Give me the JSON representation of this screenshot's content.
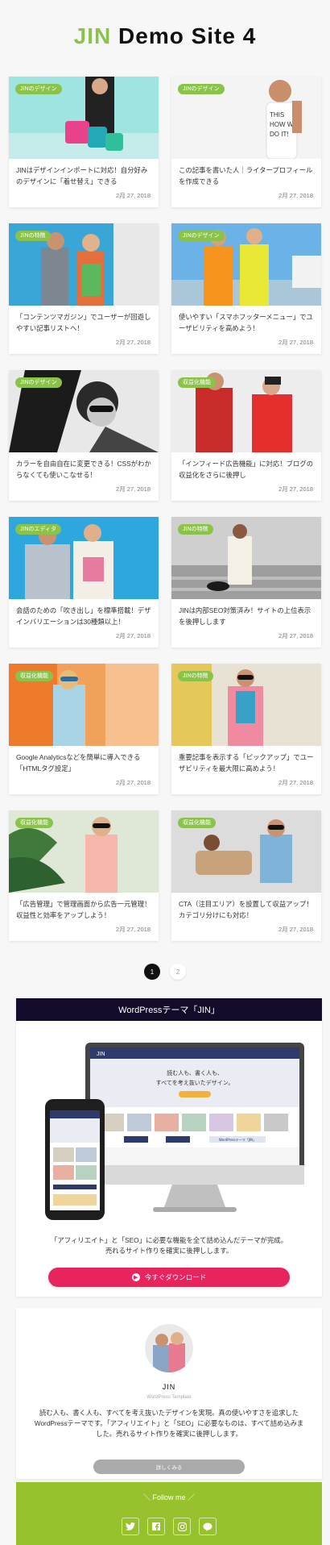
{
  "header": {
    "title_accent": "JIN",
    "title_rest": " Demo Site 4"
  },
  "posts": [
    {
      "category": "JINのデザイン",
      "title": "JINはデザインインポートに対応！自分好みのデザインに「着せ替え」できる",
      "date": "2月 27, 2018"
    },
    {
      "category": "JINのデザイン",
      "title": "この記事を書いた人｜ライタープロフィールを作成できる",
      "date": "2月 27, 2018"
    },
    {
      "category": "JINの特徴",
      "title": "「コンテンツマガジン」でユーザーが回遊しやすい記事リストへ！",
      "date": "2月 27, 2018"
    },
    {
      "category": "JINのデザイン",
      "title": "使いやすい「スマホフッターメニュー」でユーザビリティを高めよう！",
      "date": "2月 27, 2018"
    },
    {
      "category": "JINのデザイン",
      "title": "カラーを自由自在に変更できる！CSSがわからなくても使いこなせる！",
      "date": "2月 27, 2018"
    },
    {
      "category": "収益化機能",
      "title": "「インフィード広告機能」に対応！ブログの収益化をさらに後押し",
      "date": "2月 27, 2018"
    },
    {
      "category": "JINのエディタ",
      "title": "会話のための「吹き出し」を標準搭載！デザインバリエーションは30種類以上！",
      "date": "2月 27, 2018"
    },
    {
      "category": "JINの特徴",
      "title": "JINは内部SEO対策済み！サイトの上位表示を後押しします",
      "date": "2月 27, 2018"
    },
    {
      "category": "収益化機能",
      "title": "Google Analyticsなどを簡単に導入できる「HTMLタグ設定」",
      "date": "2月 27, 2018"
    },
    {
      "category": "JINの特徴",
      "title": "重要記事を表示する「ピックアップ」でユーザビリティを最大限に高めよう！",
      "date": "2月 27, 2018"
    },
    {
      "category": "収益化機能",
      "title": "「広告管理」で管理画面から広告一元管理！収益性と効率をアップしよう！",
      "date": "2月 27, 2018"
    },
    {
      "category": "収益化機能",
      "title": "CTA（注目エリア）を設置して収益アップ！カテゴリ分けにも対応！",
      "date": "2月 27, 2018"
    }
  ],
  "pagination": {
    "current": "1",
    "next": "2"
  },
  "jin_widget": {
    "title": "WordPressテーマ「JIN」",
    "desc_line1": "「アフィリエイト」と「SEO」に必要な機能を全て詰め込んだテーマが完成。",
    "desc_line2": "売れるサイト作りを確実に後押しします。",
    "button": "今すぐダウンロード",
    "mock_logo": "JIN",
    "mock_headline1": "読む人も、書く人も、",
    "mock_headline2": "すべてを考え抜いたデザイン。",
    "mock_button": "WordPressテーマ「JIN」"
  },
  "profile": {
    "name": "JIN",
    "subtitle": "WordPress Template",
    "bio": "読む人も、書く人も、すべてを考え抜いたデザインを実現。真の使いやすさを追求したWordPressテーマです。「アフィリエイト」と「SEO」に必要なものは、すべて詰め込みました。売れるサイト作りを確実に後押しします。",
    "more_button": "詳しくみる"
  },
  "follow": {
    "title": "＼ Follow me ／",
    "icons": [
      "twitter-icon",
      "facebook-icon",
      "instagram-icon",
      "line-icon"
    ]
  },
  "colors": {
    "accent_green": "#8bc34a",
    "badge_green": "#8bc34a",
    "download_pink": "#e8245e",
    "widget_header": "#150b2a",
    "follow_bg": "#97c22e"
  }
}
